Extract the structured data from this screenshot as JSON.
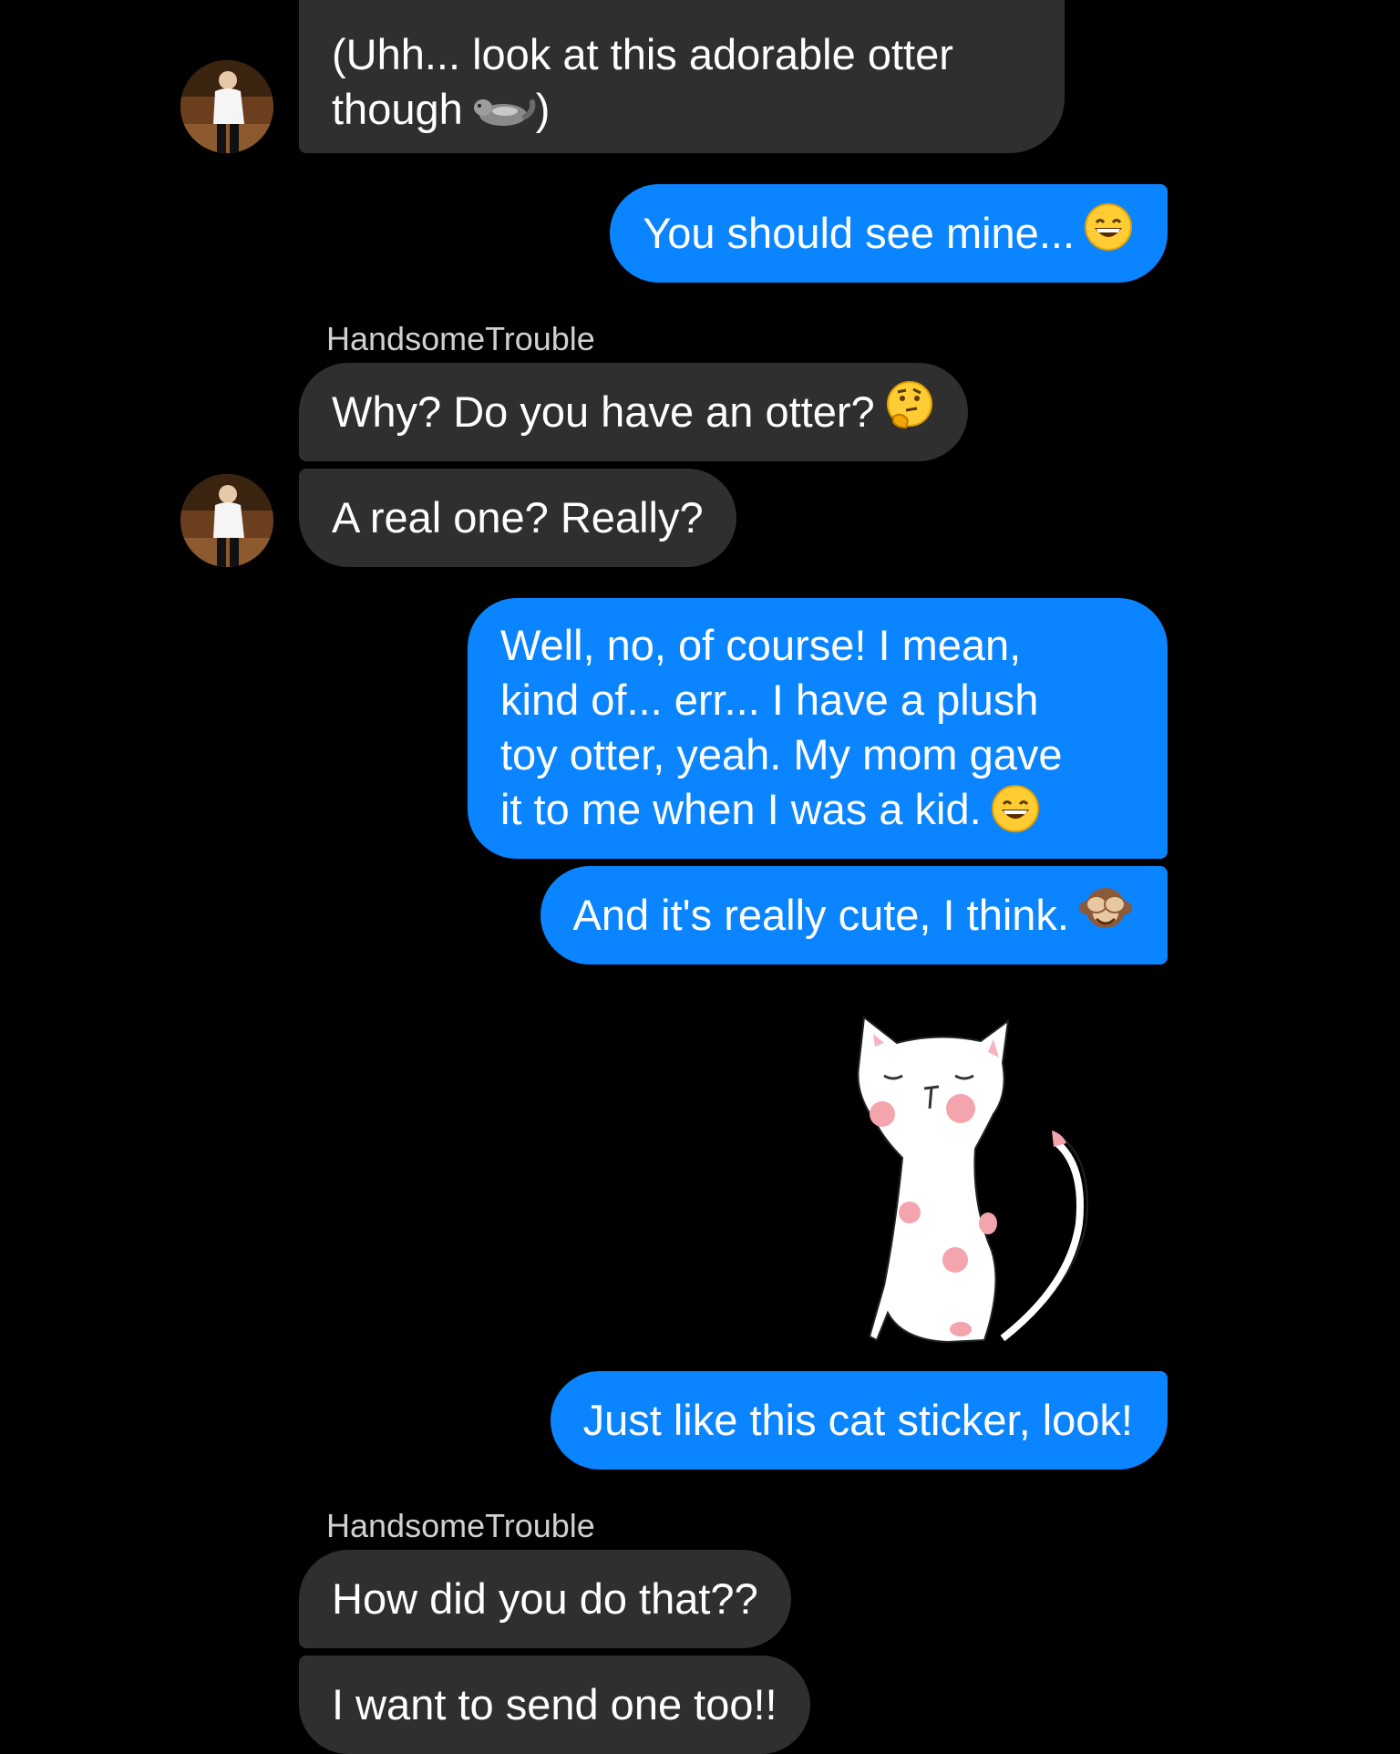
{
  "conversation": {
    "contact_name": "HandsomeTrouble",
    "messages": [
      {
        "from": "them",
        "lines": [
          "(Uhh... look at this adorable otter",
          "though"
        ],
        "emoji": "otter",
        "suffix": ")"
      },
      {
        "from": "me",
        "text": "You should see mine...",
        "emoji": "grinning-face"
      },
      {
        "from": "them",
        "sender": "HandsomeTrouble",
        "text": "Why? Do you have an otter?",
        "emoji": "thinking-face"
      },
      {
        "from": "them",
        "text": "A real one? Really?"
      },
      {
        "from": "me",
        "lines": [
          "Well, no, of course! I mean,",
          "kind of... err... I have a plush",
          "toy otter, yeah. My mom gave",
          "it to me when I was a kid."
        ],
        "emoji": "grinning-face"
      },
      {
        "from": "me",
        "text": "And it's really cute, I think.",
        "emoji": "see-no-evil-monkey"
      },
      {
        "from": "me",
        "type": "sticker",
        "sticker": "cat-sticker"
      },
      {
        "from": "me",
        "text": "Just like this cat sticker, look!"
      },
      {
        "from": "them",
        "sender": "HandsomeTrouble",
        "text": "How did you do that??"
      },
      {
        "from": "them",
        "text": "I want to send one too!!"
      }
    ]
  },
  "colors": {
    "background": "#000000",
    "incoming_bubble": "#2f2f2f",
    "outgoing_bubble": "#0a84ff",
    "text": "#ffffff",
    "sender_name": "#d0d0d0"
  }
}
